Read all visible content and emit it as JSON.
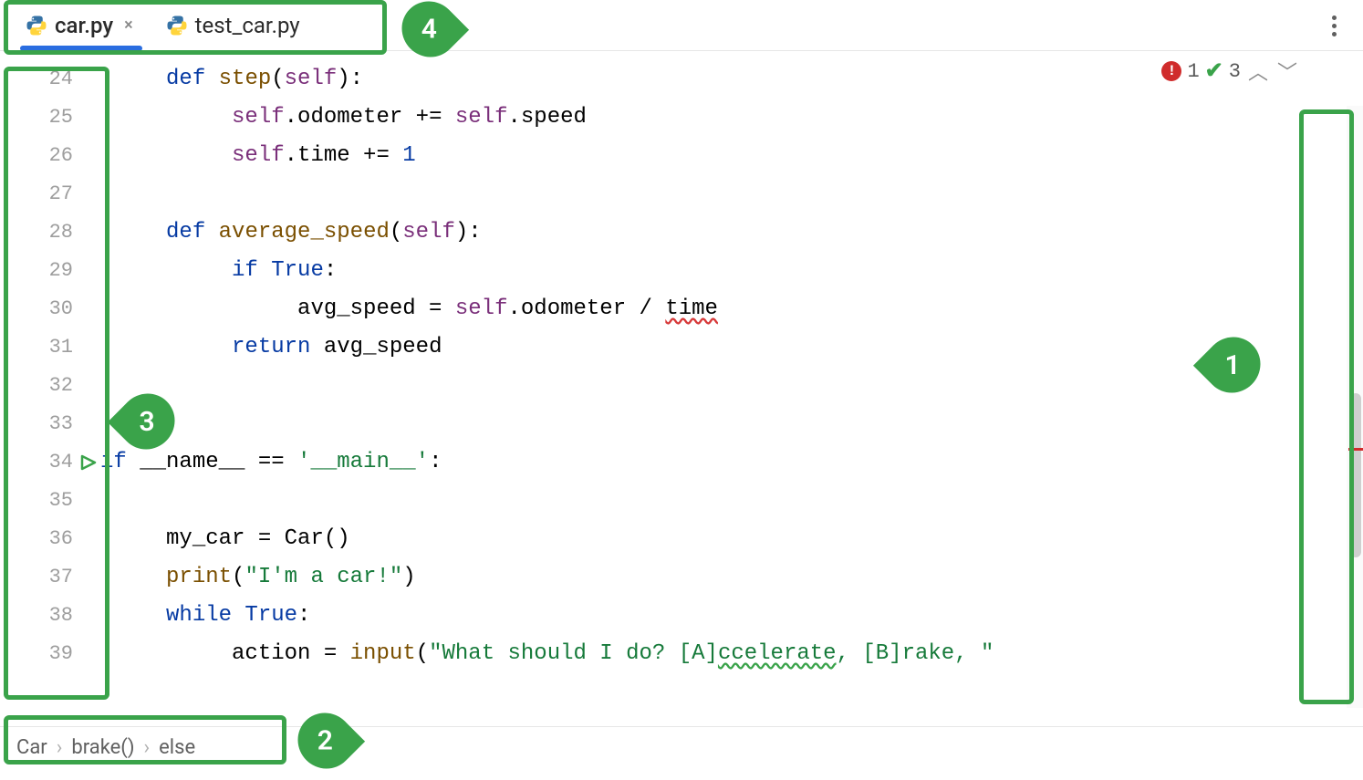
{
  "tabs": [
    {
      "label": "car.py",
      "active": true,
      "closable": true
    },
    {
      "label": "test_car.py",
      "active": false,
      "closable": false
    }
  ],
  "status": {
    "error_count": "1",
    "warn_count": "3"
  },
  "gutter_start": 24,
  "lines": [
    {
      "n": 24,
      "html": "    <span class='kw'>def</span> <span class='fn'>step</span>(<span class='self'>self</span>):"
    },
    {
      "n": 25,
      "html": "        <span class='self'>self</span>.odometer += <span class='self'>self</span>.speed"
    },
    {
      "n": 26,
      "html": "        <span class='self'>self</span>.time += <span class='kw'>1</span>"
    },
    {
      "n": 27,
      "html": ""
    },
    {
      "n": 28,
      "html": "    <span class='kw'>def</span> <span class='fn'>average_speed</span>(<span class='self'>self</span>):"
    },
    {
      "n": 29,
      "html": "        <span class='kw'>if True</span>:"
    },
    {
      "n": 30,
      "html": "            avg_speed = <span class='self'>self</span>.odometer / <span class='squiggle-red'>time</span>"
    },
    {
      "n": 31,
      "html": "        <span class='kw'>return</span> avg_speed"
    },
    {
      "n": 32,
      "html": ""
    },
    {
      "n": 33,
      "html": ""
    },
    {
      "n": 34,
      "html": "<span class='kw'>if</span> __name__ == <span class='str'>'__main__'</span>:",
      "run": true
    },
    {
      "n": 35,
      "html": ""
    },
    {
      "n": 36,
      "html": "    my_car = Car()"
    },
    {
      "n": 37,
      "html": "    <span class='fn'>print</span>(<span class='str'>\"I'm a car!\"</span>)"
    },
    {
      "n": 38,
      "html": "    <span class='kw'>while True</span>:"
    },
    {
      "n": 39,
      "html": "        action = <span class='fn'>input</span>(<span class='str'>\"What should I do? [A]<span class='squiggle-green'>ccelerate</span>, [B]rake, \"</span>"
    }
  ],
  "breadcrumb": [
    "Car",
    "brake()",
    "else"
  ],
  "callouts": {
    "c1": "1",
    "c2": "2",
    "c3": "3",
    "c4": "4"
  }
}
